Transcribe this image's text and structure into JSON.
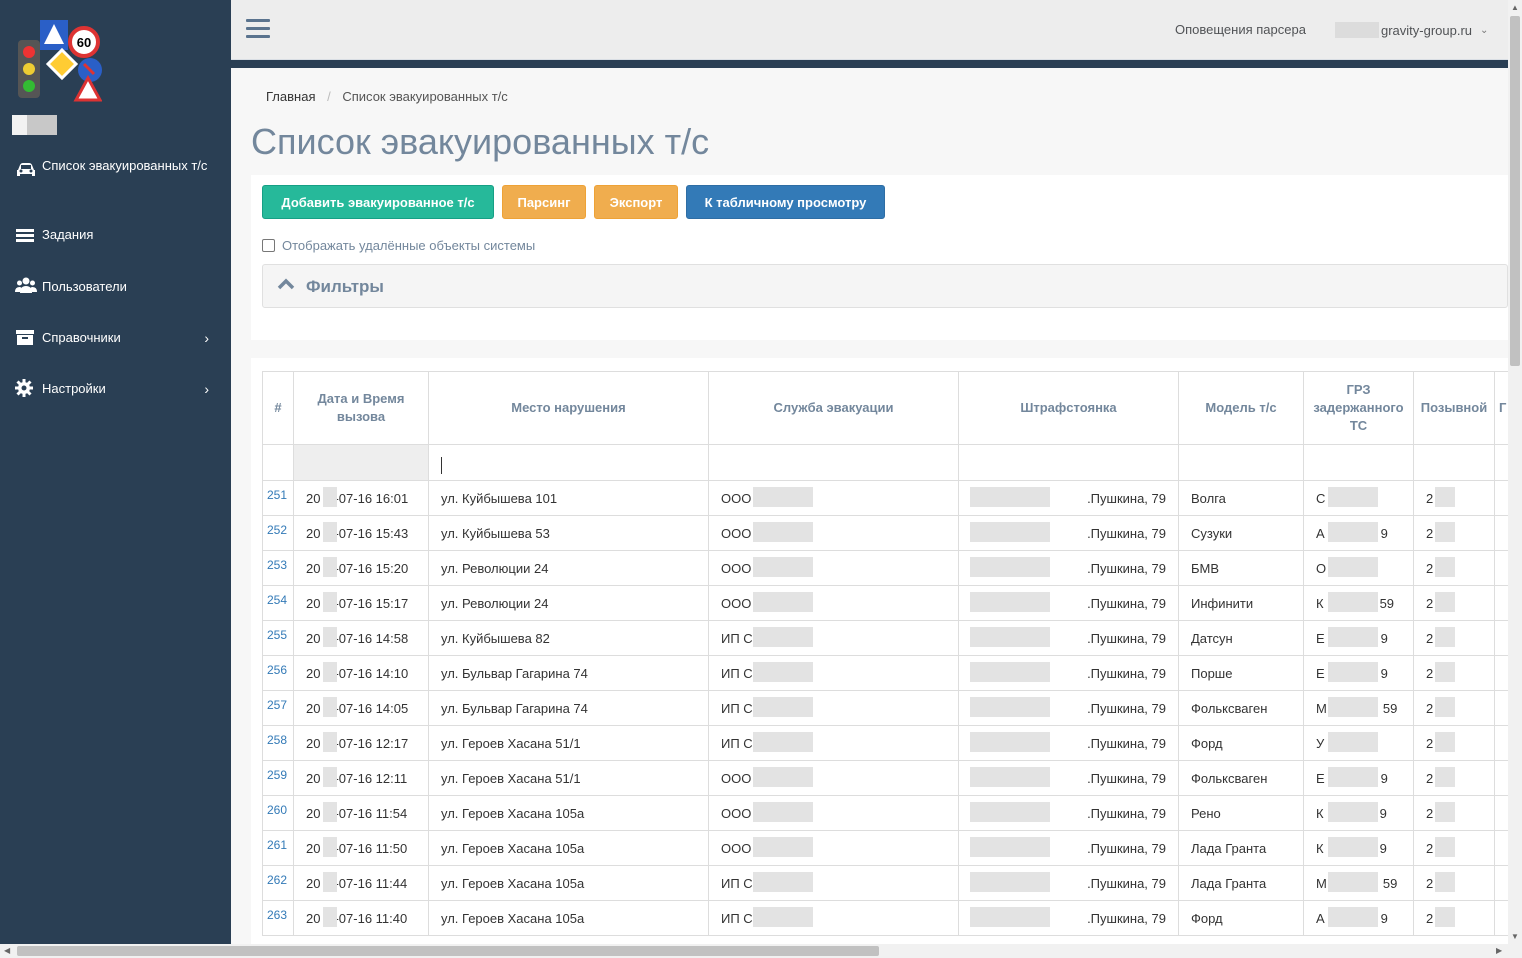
{
  "sidebar": {
    "items": [
      {
        "label": "Список эвакуированных т/с",
        "icon": "car-icon"
      },
      {
        "label": "Задания",
        "icon": "list-icon"
      },
      {
        "label": "Пользователи",
        "icon": "users-icon"
      },
      {
        "label": "Справочники",
        "icon": "archive-icon",
        "chevron": "›"
      },
      {
        "label": "Настройки",
        "icon": "gear-icon",
        "chevron": "›"
      }
    ]
  },
  "topbar": {
    "notifications": "Оповещения парсера",
    "account": "gravity-group.ru"
  },
  "breadcrumb": {
    "home": "Главная",
    "current": "Список эвакуированных т/с"
  },
  "page": {
    "title": "Список эвакуированных т/с"
  },
  "toolbar": {
    "add_label": "Добавить эвакуированное т/с",
    "parse_label": "Парсинг",
    "export_label": "Экспорт",
    "table_view_label": "К табличному просмотру",
    "show_deleted_label": "Отображать удалённые объекты системы"
  },
  "filters": {
    "label": "Фильтры"
  },
  "table": {
    "headers": [
      "#",
      "Дата и Время вызова",
      "Место нарушения",
      "Служба эвакуации",
      "Штрафстоянка",
      "Модель т/с",
      "ГРЗ задержанного ТС",
      "Позывной",
      "Г"
    ],
    "rows": [
      {
        "n": "251",
        "dt": "20",
        "dt2": "-07-16 16:01",
        "place": "ул. Куйбышева 101",
        "service": "ООО",
        "lot": ".Пушкина, 79",
        "model": "Волга",
        "grz": "С",
        "grz2": "",
        "call": "2"
      },
      {
        "n": "252",
        "dt": "20",
        "dt2": "-07-16 15:43",
        "place": "ул. Куйбышева 53",
        "service": "ООО",
        "lot": ".Пушкина, 79",
        "model": "Сузуки",
        "grz": "А",
        "grz2": "9",
        "call": "2"
      },
      {
        "n": "253",
        "dt": "20",
        "dt2": "-07-16 15:20",
        "place": "ул. Революции 24",
        "service": "ООО",
        "lot": ".Пушкина, 79",
        "model": "БМВ",
        "grz": "О",
        "grz2": "",
        "call": "2"
      },
      {
        "n": "254",
        "dt": "20",
        "dt2": "-07-16 15:17",
        "place": "ул. Революции 24",
        "service": "ООО",
        "lot": ".Пушкина, 79",
        "model": "Инфинити",
        "grz": "К",
        "grz2": "59",
        "call": "2"
      },
      {
        "n": "255",
        "dt": "20",
        "dt2": "-07-16 14:58",
        "place": "ул. Куйбышева 82",
        "service": "ИП С",
        "lot": ".Пушкина, 79",
        "model": "Датсун",
        "grz": "Е",
        "grz2": "9",
        "call": "2"
      },
      {
        "n": "256",
        "dt": "20",
        "dt2": "-07-16 14:10",
        "place": "ул. Бульвар Гагарина 74",
        "service": "ИП С",
        "lot": ".Пушкина, 79",
        "model": "Порше",
        "grz": "Е",
        "grz2": "9",
        "call": "2"
      },
      {
        "n": "257",
        "dt": "20",
        "dt2": "-07-16 14:05",
        "place": "ул. Бульвар Гагарина 74",
        "service": "ИП С",
        "lot": ".Пушкина, 79",
        "model": "Фольксваген",
        "grz": "М",
        "grz2": "59",
        "call": "2"
      },
      {
        "n": "258",
        "dt": "20",
        "dt2": "-07-16 12:17",
        "place": "ул. Героев Хасана 51/1",
        "service": "ИП С",
        "lot": ".Пушкина, 79",
        "model": "Форд",
        "grz": "У",
        "grz2": "",
        "call": "2"
      },
      {
        "n": "259",
        "dt": "20",
        "dt2": "-07-16 12:11",
        "place": "ул. Героев Хасана 51/1",
        "service": "ООО",
        "lot": ".Пушкина, 79",
        "model": "Фольксваген",
        "grz": "Е",
        "grz2": "9",
        "call": "2"
      },
      {
        "n": "260",
        "dt": "20",
        "dt2": "-07-16 11:54",
        "place": "ул. Героев Хасана 105а",
        "service": "ООО",
        "lot": ".Пушкина, 79",
        "model": "Рено",
        "grz": "К",
        "grz2": "9",
        "call": "2"
      },
      {
        "n": "261",
        "dt": "20",
        "dt2": "-07-16 11:50",
        "place": "ул. Героев Хасана 105а",
        "service": "ООО",
        "lot": ".Пушкина, 79",
        "model": "Лада Гранта",
        "grz": "К",
        "grz2": "9",
        "call": "2"
      },
      {
        "n": "262",
        "dt": "20",
        "dt2": "-07-16 11:44",
        "place": "ул. Героев Хасана 105а",
        "service": "ИП С",
        "lot": ".Пушкина, 79",
        "model": "Лада Гранта",
        "grz": "М",
        "grz2": "59",
        "call": "2"
      },
      {
        "n": "263",
        "dt": "20",
        "dt2": "-07-16 11:40",
        "place": "ул. Героев Хасана 105а",
        "service": "ИП С",
        "lot": ".Пушкина, 79",
        "model": "Форд",
        "grz": "А",
        "grz2": "9",
        "call": "2"
      }
    ]
  },
  "colors": {
    "sidebar": "#2a3f54",
    "primary": "#337ab7",
    "success": "#26b99a",
    "warning": "#f0ad4e",
    "title": "#73879c"
  }
}
